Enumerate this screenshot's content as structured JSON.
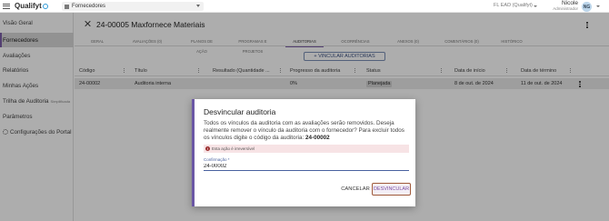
{
  "topbar": {
    "app_name": "Qualifyt",
    "module": "Fornecedores",
    "company": "FL EAD (Qualifyt)",
    "user_name": "Nicole",
    "user_role": "Administrador",
    "avatar_initials": "NG"
  },
  "sidebar": {
    "items": [
      {
        "label": "Visão Geral"
      },
      {
        "label": "Fornecedores",
        "active": true
      },
      {
        "label": "Avaliações"
      },
      {
        "label": "Relatórios"
      },
      {
        "label": "Minhas Ações"
      },
      {
        "label": "Trilha de Auditoria",
        "suffix": "Simplificada"
      },
      {
        "label": "Parâmetros"
      },
      {
        "label": "Configurações do Portal"
      }
    ]
  },
  "detail": {
    "title": "24-00005 Maxfornece Materiais",
    "tabs": [
      {
        "label": "GERAL"
      },
      {
        "label": "AVALIAÇÕES (0)"
      },
      {
        "label": "PLANOS DE AÇÃO"
      },
      {
        "label": "PROGRAMAS E PROJETOS"
      },
      {
        "label": "AUDITORIAS",
        "active": true
      },
      {
        "label": "OCORRÊNCIAS"
      },
      {
        "label": "ANEXOS (0)"
      },
      {
        "label": "COMENTÁRIOS (0)"
      },
      {
        "label": "HISTÓRICO"
      }
    ],
    "link_button": "+ VINCULAR AUDITORIAS"
  },
  "table": {
    "columns": [
      "Código",
      "Título",
      "Resultado (Quantidade ...",
      "Progresso da auditoria",
      "Status",
      "Data de início",
      "Data de término"
    ],
    "rows": [
      [
        "24-00002",
        "Auditoria interna",
        "",
        "0%",
        "Planejada",
        "8 de out. de 2024",
        "11 de out. de 2024"
      ]
    ]
  },
  "dialog": {
    "title": "Desvincular auditoria",
    "body_text": "Todos os vínculos da auditoria com as avaliações serão removidos. Deseja realmente remover o vínculo da auditoria com o fornecedor? Para excluir todos os vínculos digite o código da auditoria: ",
    "body_code": "24-00002",
    "warning": "Esta ação é irreversível",
    "field_label": "Confirmação *",
    "field_value": "24-00002",
    "cancel_label": "CANCELAR",
    "confirm_label": "DESVINCULAR"
  }
}
